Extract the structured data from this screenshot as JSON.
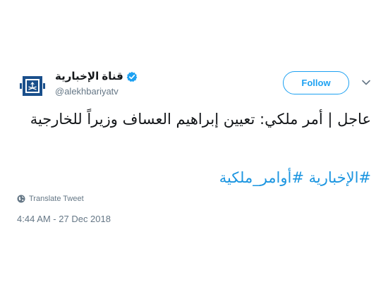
{
  "account": {
    "display_name": "قناة الإخبارية",
    "handle": "@alekhbariyatv",
    "verified": true
  },
  "follow_button": {
    "label": "Follow"
  },
  "tweet": {
    "text": "عاجل | أمر ملكي: تعيين إبراهيم العساف وزيراً للخارجية",
    "hashtags": [
      "#الإخبارية",
      "#أوامر_ملكية"
    ]
  },
  "translate": {
    "label": "Translate Tweet"
  },
  "timestamp": "4:44 AM - 27 Dec 2018",
  "icons": {
    "verified": "verified-badge-icon",
    "caret": "chevron-down-icon",
    "globe": "globe-icon",
    "avatar": "channel-logo"
  },
  "colors": {
    "accent": "#1da1f2",
    "hashtag": "#1b95e0",
    "secondary_text": "#657786",
    "primary_text": "#14171a",
    "logo_blue": "#1a4f8b"
  }
}
